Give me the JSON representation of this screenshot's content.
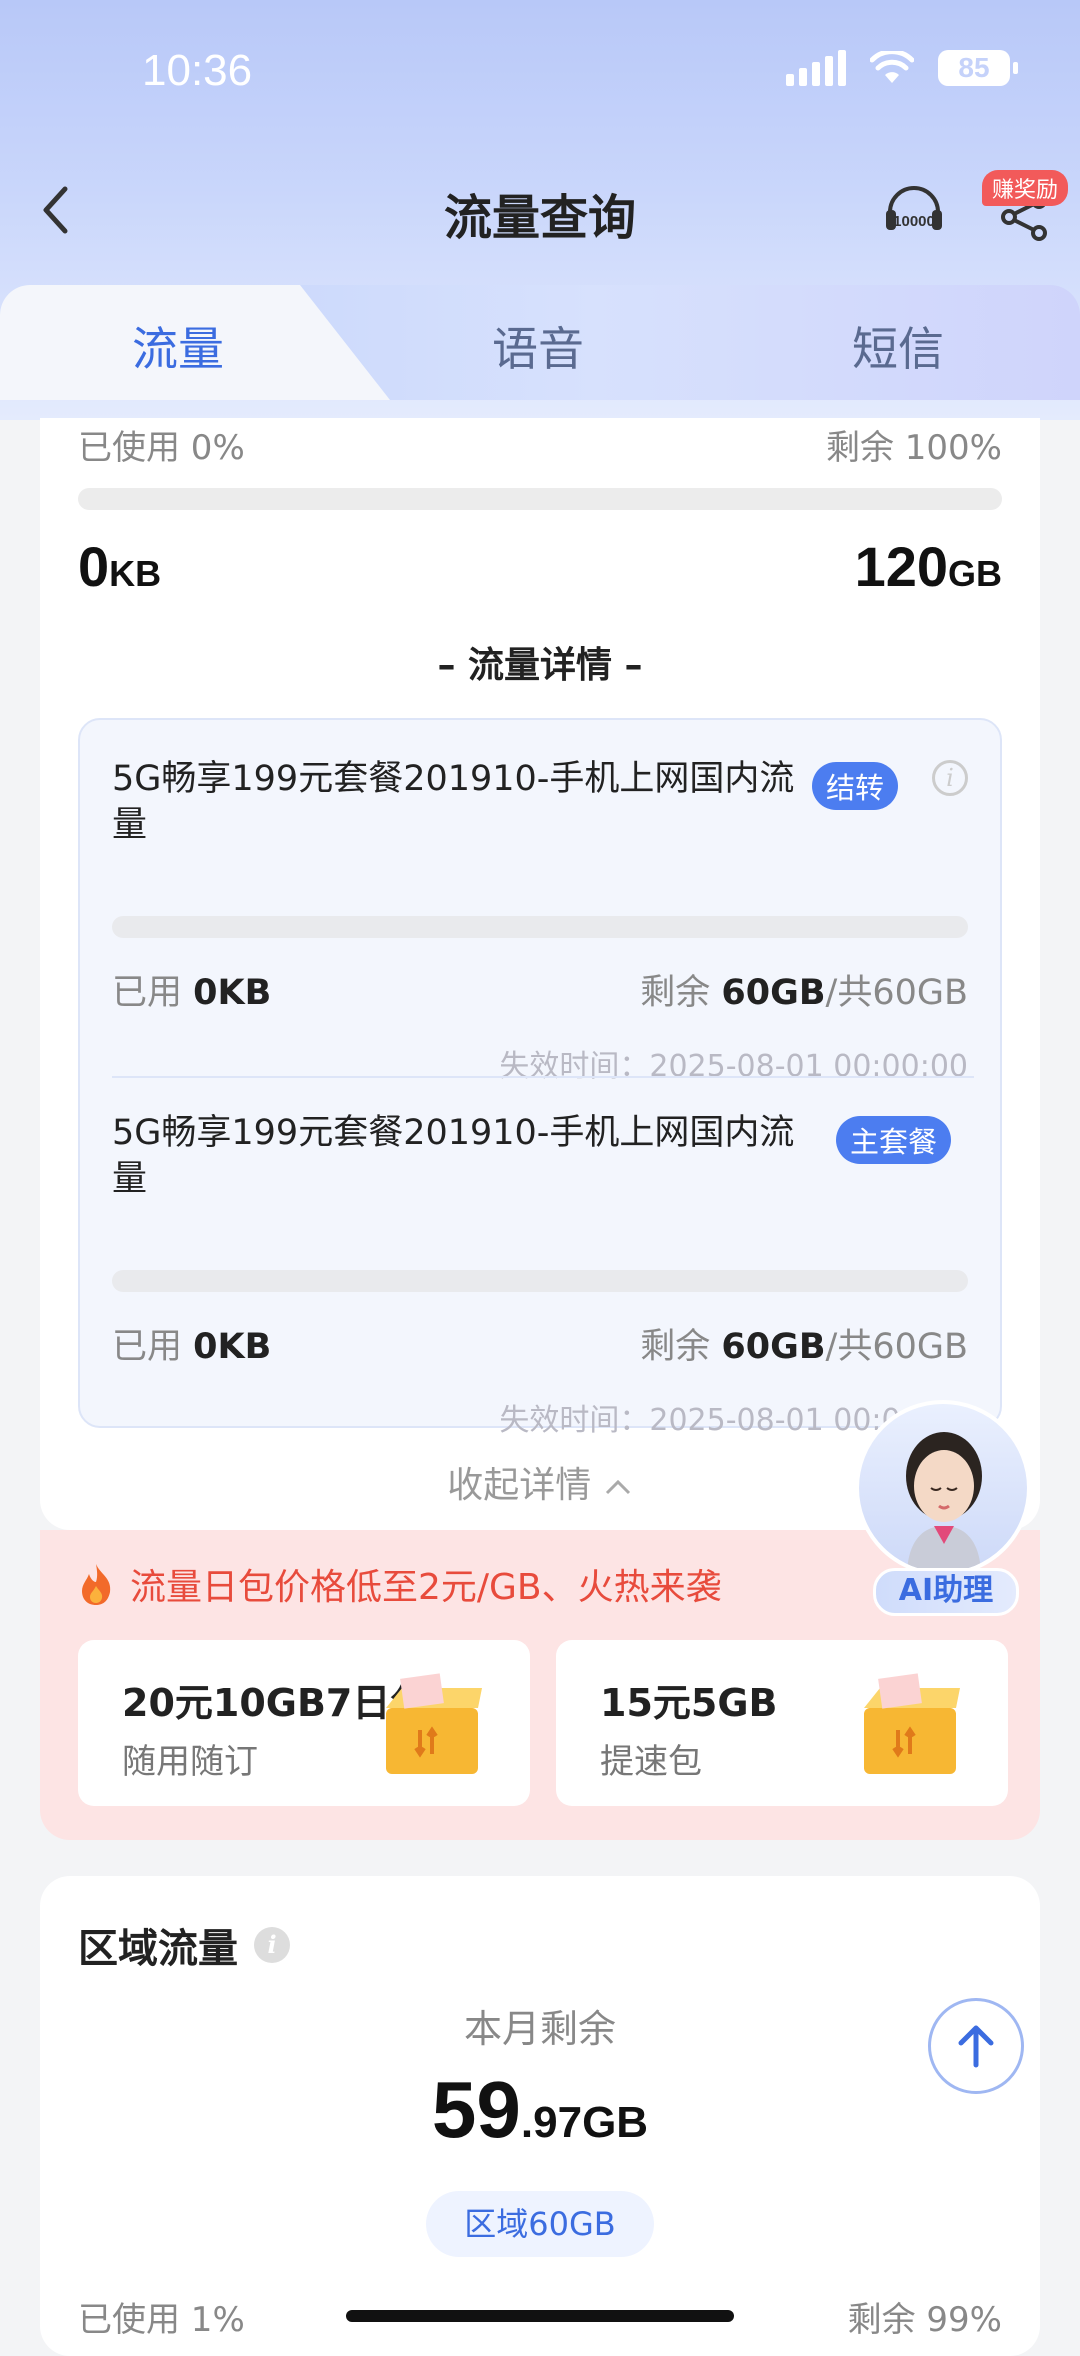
{
  "status": {
    "time": "10:36",
    "battery": "85"
  },
  "nav": {
    "title": "流量查询",
    "reward_badge": "赚奖励"
  },
  "tabs": [
    {
      "label": "流量",
      "active": true
    },
    {
      "label": "语音",
      "active": false
    },
    {
      "label": "短信",
      "active": false
    }
  ],
  "summary": {
    "used_pct": "已使用 0%",
    "remain_pct": "剩余 100%",
    "used_num": "0",
    "used_unit": "KB",
    "total_num": "120",
    "total_unit": "GB",
    "used_fraction": 0
  },
  "detail_title": "– 流量详情 –",
  "packages": [
    {
      "name": "5G畅享199元套餐201910-手机上网国内流量",
      "tag": "结转",
      "used_label": "已用",
      "used_value": "0KB",
      "remain_label": "剩余",
      "remain_value": "60GB",
      "total": "/共60GB",
      "expire": "失效时间：2025-08-01 00:00:00"
    },
    {
      "name": "5G畅享199元套餐201910-手机上网国内流量",
      "tag": "主套餐",
      "used_label": "已用",
      "used_value": "0KB",
      "remain_label": "剩余",
      "remain_value": "60GB",
      "total": "/共60GB",
      "expire": "失效时间：2025-08-01 00:00:00"
    }
  ],
  "collapse_label": "收起详情",
  "promo": {
    "text": "流量日包价格低至2元/GB、火热来袭",
    "cards": [
      {
        "title": "20元10GB7日包",
        "sub": "随用随订"
      },
      {
        "title": "15元5GB",
        "sub": "提速包"
      }
    ]
  },
  "assistant_label": "AI助理",
  "region": {
    "title": "区域流量",
    "month_label": "本月剩余",
    "value_int": "59",
    "value_dec": ".97GB",
    "chip": "区域60GB",
    "used_pct": "已使用 1%",
    "remain_pct": "剩余 99%"
  },
  "colors": {
    "accent": "#3b6ce0",
    "promo_red": "#e84b3c",
    "tag_blue": "#4c7df0"
  }
}
